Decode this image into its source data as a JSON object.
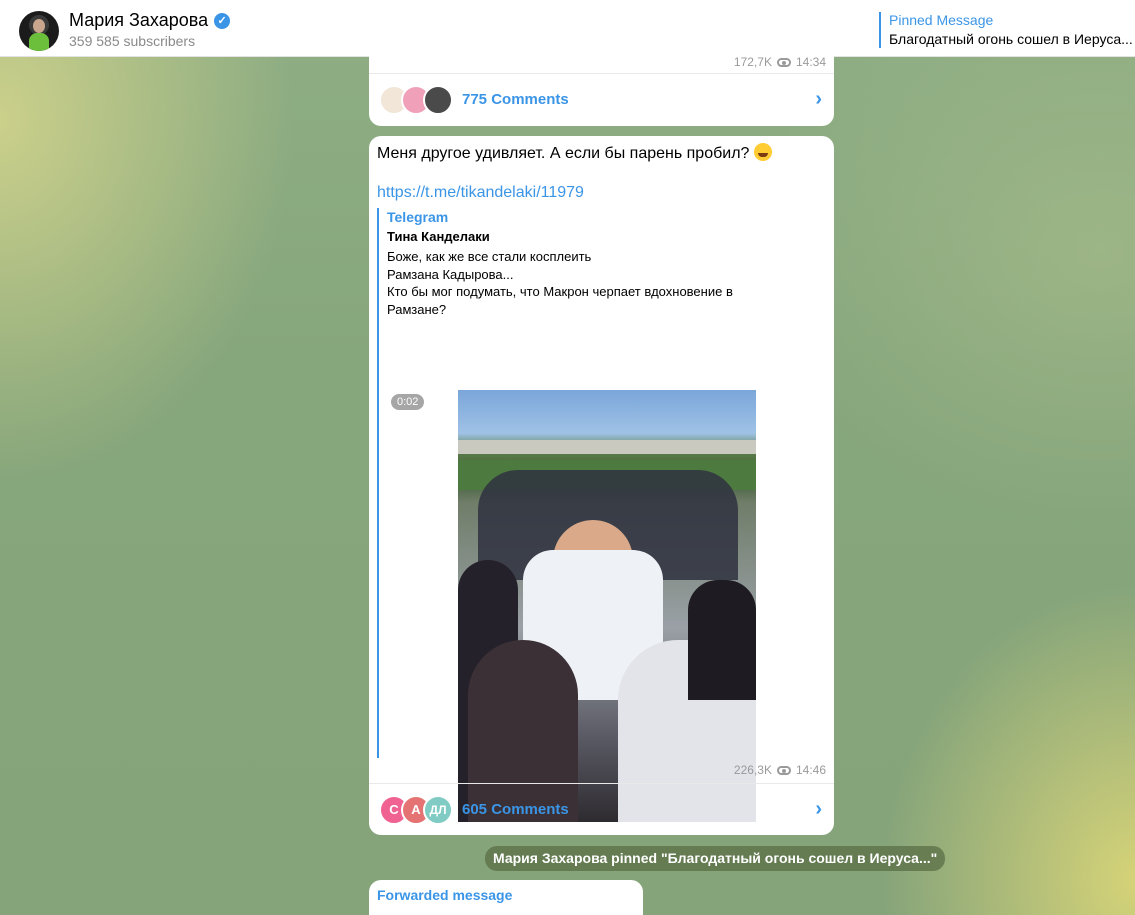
{
  "header": {
    "channel_name": "Мария Захарова",
    "verified_icon": "verified-badge-icon",
    "subscribers": "359 585 subscribers",
    "pinned": {
      "title": "Pinned Message",
      "text": "Благодатный огонь сошел в Иеруса..."
    }
  },
  "messages": [
    {
      "views": "172,7K",
      "time": "14:34",
      "comments_label": "775 Comments"
    },
    {
      "text": "Меня другое удивляет. А если бы парень пробил?",
      "emoji": "laughing-crying-emoji",
      "link": "https://t.me/tikandelaki/11979",
      "preview": {
        "site": "Telegram",
        "title": "Тина Канделаки",
        "lines": [
          "Боже, как же все стали косплеить",
          "Рамзана Кадырова...",
          "Кто бы мог подумать, что Макрон черпает вдохновение в",
          "Рамзане?"
        ],
        "video_duration": "0:02"
      },
      "views": "226,3K",
      "time": "14:46",
      "comment_avatars": [
        "С",
        "А",
        "ДЛ"
      ],
      "comments_label": "605 Comments"
    },
    {
      "forwarded_label": "Forwarded message"
    }
  ],
  "service_message": "Мария Захарова pinned \"Благодатный огонь сошел в Иеруса...\"",
  "colors": {
    "accent": "#3b95e6",
    "avatar_c": "#f06292",
    "avatar_a": "#e57373",
    "avatar_dl": "#80cbc4"
  }
}
